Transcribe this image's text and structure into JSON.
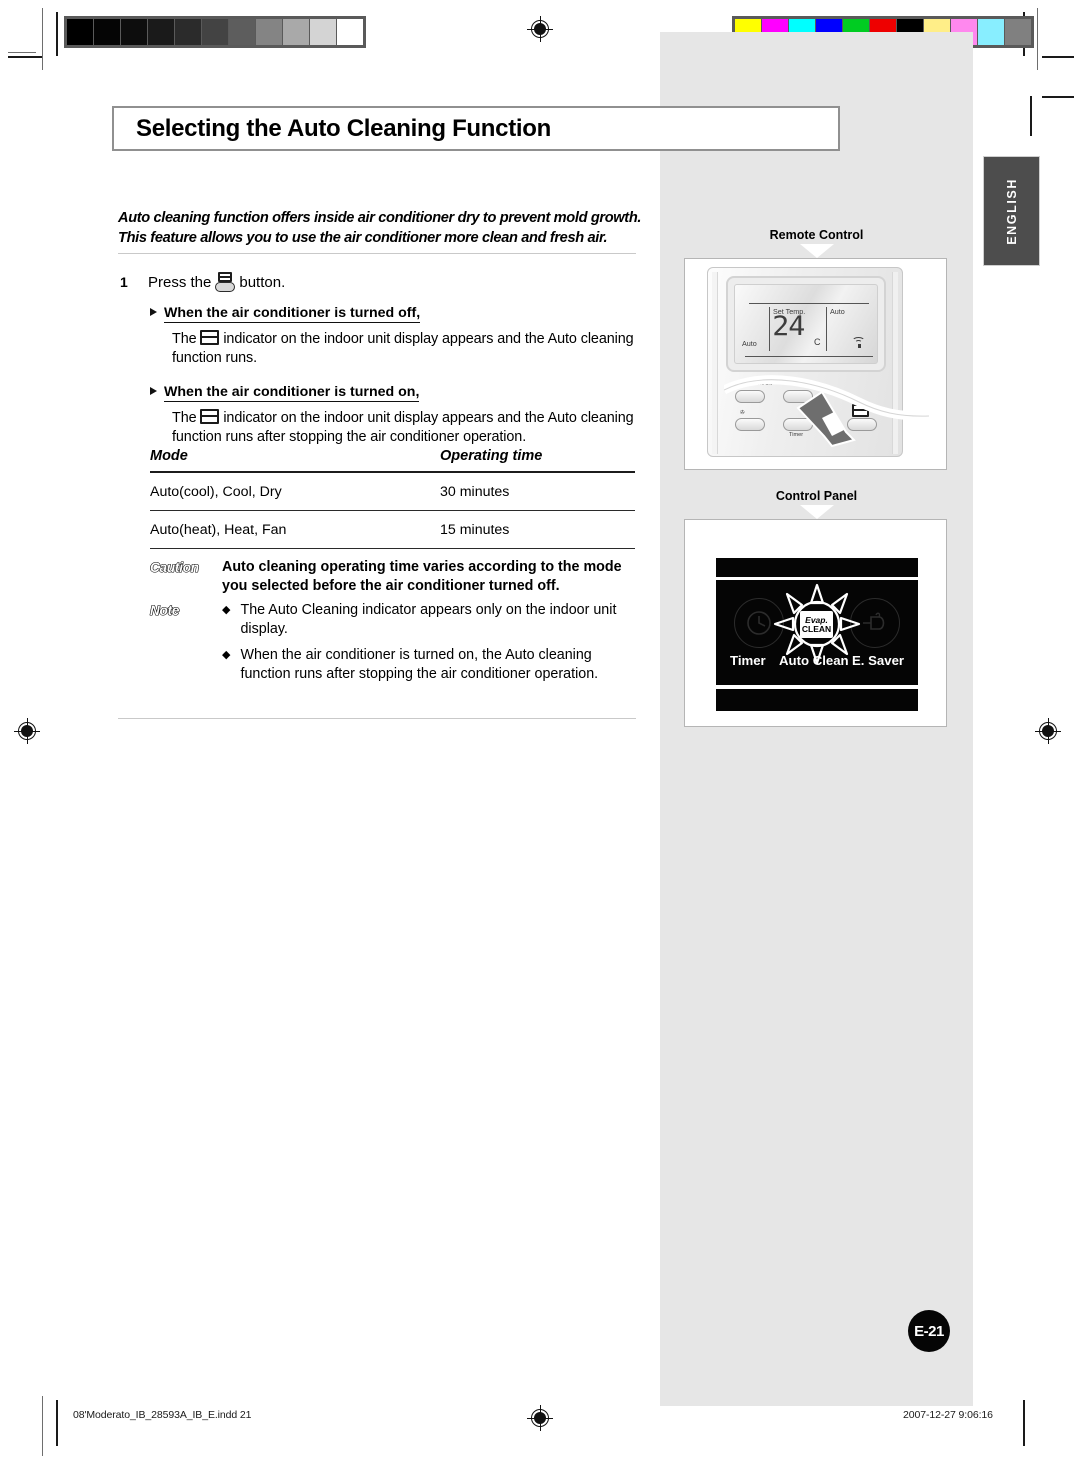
{
  "document": {
    "language_tab": "ENGLISH",
    "page_badge": "E-21",
    "footer_left": "08'Moderato_IB_28593A_IB_E.indd   21",
    "footer_right": "2007-12-27   9:06:16"
  },
  "header": {
    "title": "Selecting the Auto Cleaning Function"
  },
  "intro": {
    "line1": "Auto cleaning function offers inside air conditioner dry to prevent mold growth.",
    "line2": "This feature allows you to use the air conditioner more clean and fresh air."
  },
  "step": {
    "number": "1",
    "press_prefix": "Press the",
    "press_suffix": "button.",
    "sections": [
      {
        "heading": "When the air conditioner is turned off,",
        "body_prefix": "The",
        "body_suffix": "indicator on the indoor unit display appears and the Auto cleaning function runs."
      },
      {
        "heading": "When the air conditioner is turned on,",
        "body_prefix": "The",
        "body_suffix": "indicator on the indoor unit display appears and the Auto cleaning function runs after stopping the air conditioner operation."
      }
    ]
  },
  "table": {
    "columns": [
      "Mode",
      "Operating time"
    ],
    "rows": [
      [
        "Auto(cool), Cool, Dry",
        "30 minutes"
      ],
      [
        "Auto(heat), Heat, Fan",
        "15 minutes"
      ]
    ]
  },
  "caution": {
    "tag": "Caution",
    "text": "Auto cleaning operating time varies according to the mode you selected before the air conditioner turned off."
  },
  "note": {
    "tag": "Note",
    "bullet": "◆",
    "items": [
      "The Auto Cleaning indicator appears only on the indoor unit display.",
      "When the air conditioner is turned on, the Auto cleaning function runs after stopping the air conditioner operation."
    ]
  },
  "illustrations": {
    "remote_control": {
      "caption": "Remote Control",
      "display": {
        "set_temp_label": "Set Temp.",
        "mode_right": "Auto",
        "mode_left": "Auto",
        "temperature": "24",
        "unit": "C"
      },
      "buttons": [
        "Digital i On/Off",
        "Timer"
      ]
    },
    "control_panel": {
      "caption": "Control Panel",
      "indicator_label_top": "Evap.",
      "indicator_label_bottom": "CLEAN",
      "labels": [
        "Timer",
        "Auto Clean",
        "E. Saver"
      ]
    }
  },
  "print_marks": {
    "grayscale_bar": [
      "#000000",
      "#050505",
      "#0d0d0d",
      "#1a1a1a",
      "#2b2b2b",
      "#434343",
      "#5d5d5d",
      "#848484",
      "#a9a9a9",
      "#d4d4d4",
      "#ffffff"
    ],
    "color_bar": [
      "#ffff00",
      "#ff00ff",
      "#00ffff",
      "#0000ff",
      "#00cc22",
      "#ee0000",
      "#000000",
      "#ffee88",
      "#ff88ee",
      "#88eeff",
      "#808080"
    ]
  }
}
